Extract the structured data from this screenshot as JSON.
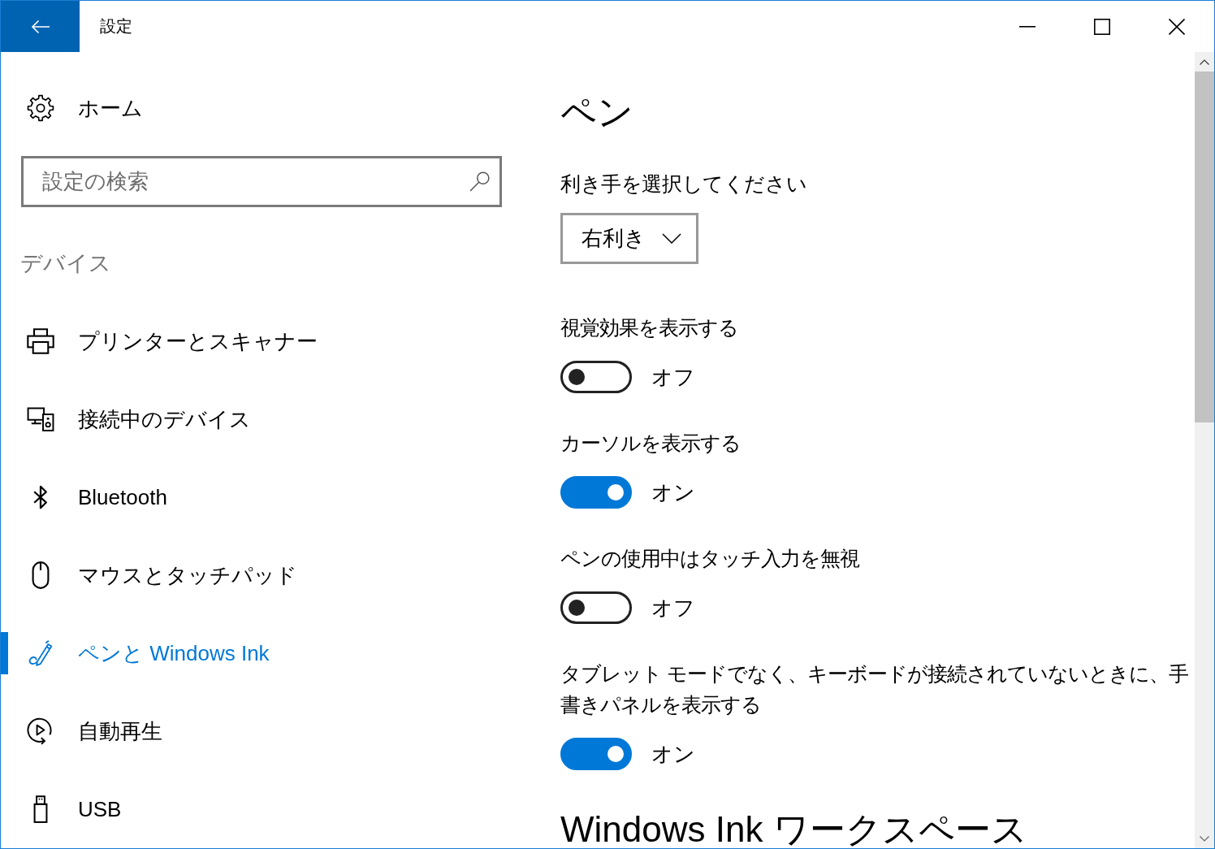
{
  "window": {
    "title": "設定"
  },
  "sidebar": {
    "home": "ホーム",
    "search": {
      "placeholder": "設定の検索"
    },
    "section": "デバイス",
    "items": [
      {
        "label": "プリンターとスキャナー",
        "selected": false
      },
      {
        "label": "接続中のデバイス",
        "selected": false
      },
      {
        "label": "Bluetooth",
        "selected": false
      },
      {
        "label": "マウスとタッチパッド",
        "selected": false
      },
      {
        "label": "ペンと Windows Ink",
        "selected": true
      },
      {
        "label": "自動再生",
        "selected": false
      },
      {
        "label": "USB",
        "selected": false
      }
    ]
  },
  "content": {
    "title": "ペン",
    "handedness": {
      "label": "利き手を選択してください",
      "value": "右利き"
    },
    "settings": [
      {
        "label": "視覚効果を表示する",
        "on": false,
        "state_label": "オフ"
      },
      {
        "label": "カーソルを表示する",
        "on": true,
        "state_label": "オン"
      },
      {
        "label": "ペンの使用中はタッチ入力を無視",
        "on": false,
        "state_label": "オフ"
      },
      {
        "label": "タブレット モードでなく、キーボードが接続されていないときに、手書きパネルを表示する",
        "on": true,
        "state_label": "オン"
      }
    ],
    "next_heading": "Windows Ink ワークスペース"
  }
}
